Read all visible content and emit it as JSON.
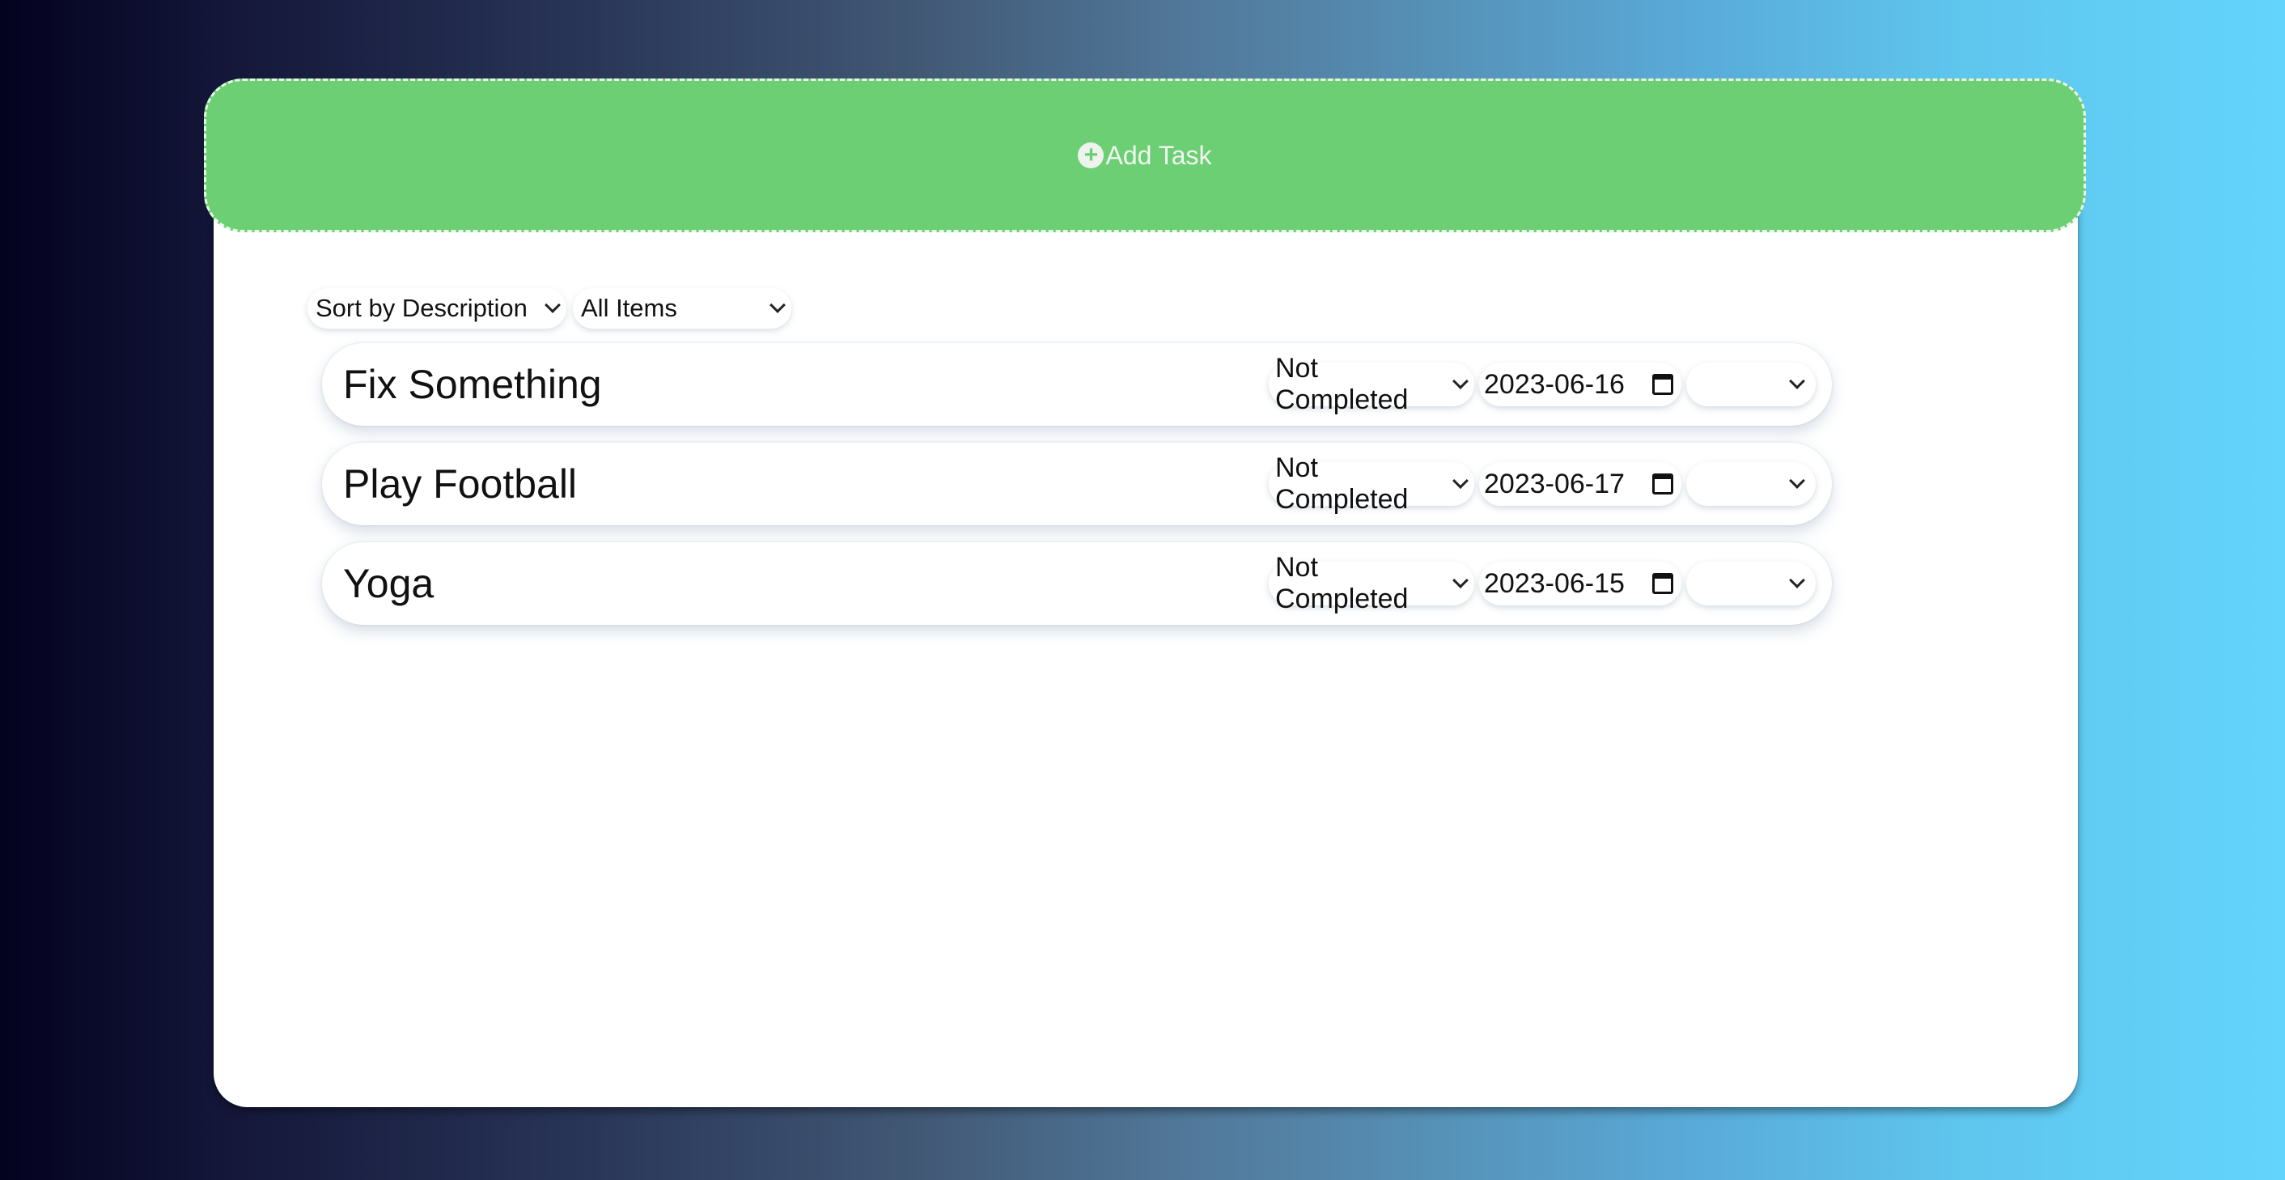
{
  "add_task": {
    "label": "Add Task",
    "icon": "plus-circle-icon"
  },
  "filters": {
    "sort": {
      "selected": "Sort by Description"
    },
    "show": {
      "selected": "All Items"
    }
  },
  "tasks": [
    {
      "description": "Fix Something",
      "status": "Not Completed",
      "due_date": "2023-06-16",
      "extra": ""
    },
    {
      "description": "Play Football",
      "status": "Not Completed",
      "due_date": "2023-06-17",
      "extra": ""
    },
    {
      "description": "Yoga",
      "status": "Not Completed",
      "due_date": "2023-06-15",
      "extra": ""
    }
  ],
  "colors": {
    "add_task_bg": "#6ccf73",
    "card_bg": "#ffffff"
  }
}
